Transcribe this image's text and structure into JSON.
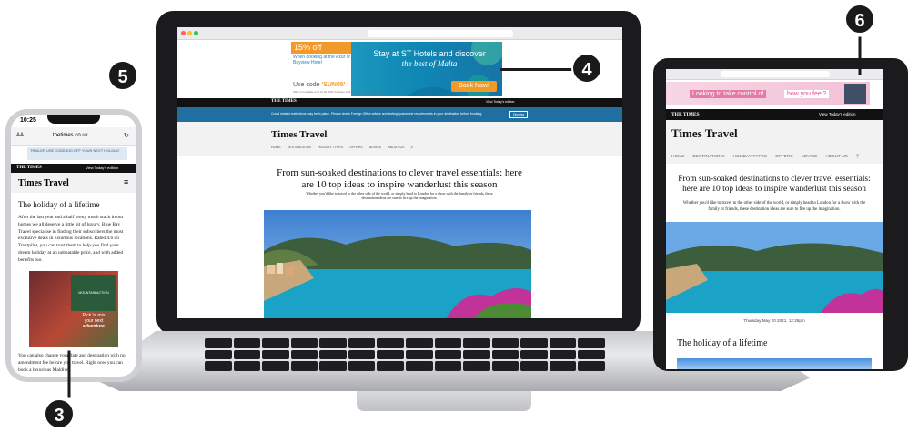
{
  "callouts": [
    "5",
    "4",
    "6",
    "3"
  ],
  "laptop": {
    "ad": {
      "discount": "15% off",
      "booking_note": "When booking at the Azur or Bayview Hotel",
      "code_prefix": "Use code ",
      "code": "'SUN05'",
      "fine_print": "Offer is bookable until 11.06.2021 for stays until the 31st December 2021",
      "headline_1": "Stay at ST Hotels and discover",
      "headline_2": "the best of Malta",
      "cta": "Book Now!"
    },
    "masthead": {
      "logo": "THE TIMES",
      "edition": "View Today's edition"
    },
    "notice": {
      "text": "Covid related restrictions may be in place. Please check Foreign Office advice and testing/quarantine requirements in your destination before booking.",
      "button": "Dismiss"
    },
    "section_title": "Times Travel",
    "nav": [
      "HOME",
      "DESTINATIONS",
      "HOLIDAY TYPES",
      "OFFERS",
      "ADVICE",
      "ABOUT US"
    ],
    "headline": "From sun-soaked destinations to clever travel essentials: here are 10 top ideas to inspire wanderlust this season",
    "subhead": "Whether you'd like to travel to the other side of the world, or simply head to London for a show with the family or friends, these destination ideas are sure to fire up the imagination."
  },
  "phone": {
    "time": "10:25",
    "text_size": "AA",
    "url": "thetimes.co.uk",
    "ad_banner": "TRAILER USE CODE £30 OFF YOUR NEXT HOLIDAY",
    "masthead": {
      "logo": "THE TIMES",
      "edition": "View Today's edition"
    },
    "section_title": "Times Travel",
    "article_title": "The holiday of a lifetime",
    "body": "After the last year and a half pretty much stuck in our homes we all deserve a little bit of luxury. Blue Bay Travel specialise in finding their subscribers the most exclusive deals in luxurious locations. Rated 4.6 on Trustpilot, you can trust them to help you find your dream holiday at an unbeatable price, and with added benefits too.",
    "ad": {
      "brand": "MOUNTAIN ACTION",
      "line1": "Pick 'n' mix",
      "line2": "your next",
      "line3": "adventure"
    },
    "body2": "You can also change your date and destination with no amendment fee before you travel. Right now you can book a luxurious Maldives"
  },
  "tablet": {
    "ad": {
      "prompt": "Looking to take control of",
      "highlight": "how you feel?"
    },
    "masthead": {
      "logo": "THE TIMES",
      "edition": "View Today's edition"
    },
    "section_title": "Times Travel",
    "nav": [
      "HOME",
      "DESTINATIONS",
      "HOLIDAY TYPES",
      "OFFERS",
      "ADVICE",
      "ABOUT US"
    ],
    "headline": "From sun-soaked destinations to clever travel essentials: here are 10 top ideas to inspire wanderlust this season",
    "subhead": "Whether you'd like to travel to the other side of the world, or simply head to London for a show with the family or friends, these destination ideas are sure to fire up the imagination.",
    "date": "Thursday May 20 2021, 12:28pm",
    "article_title": "The holiday of a lifetime"
  }
}
